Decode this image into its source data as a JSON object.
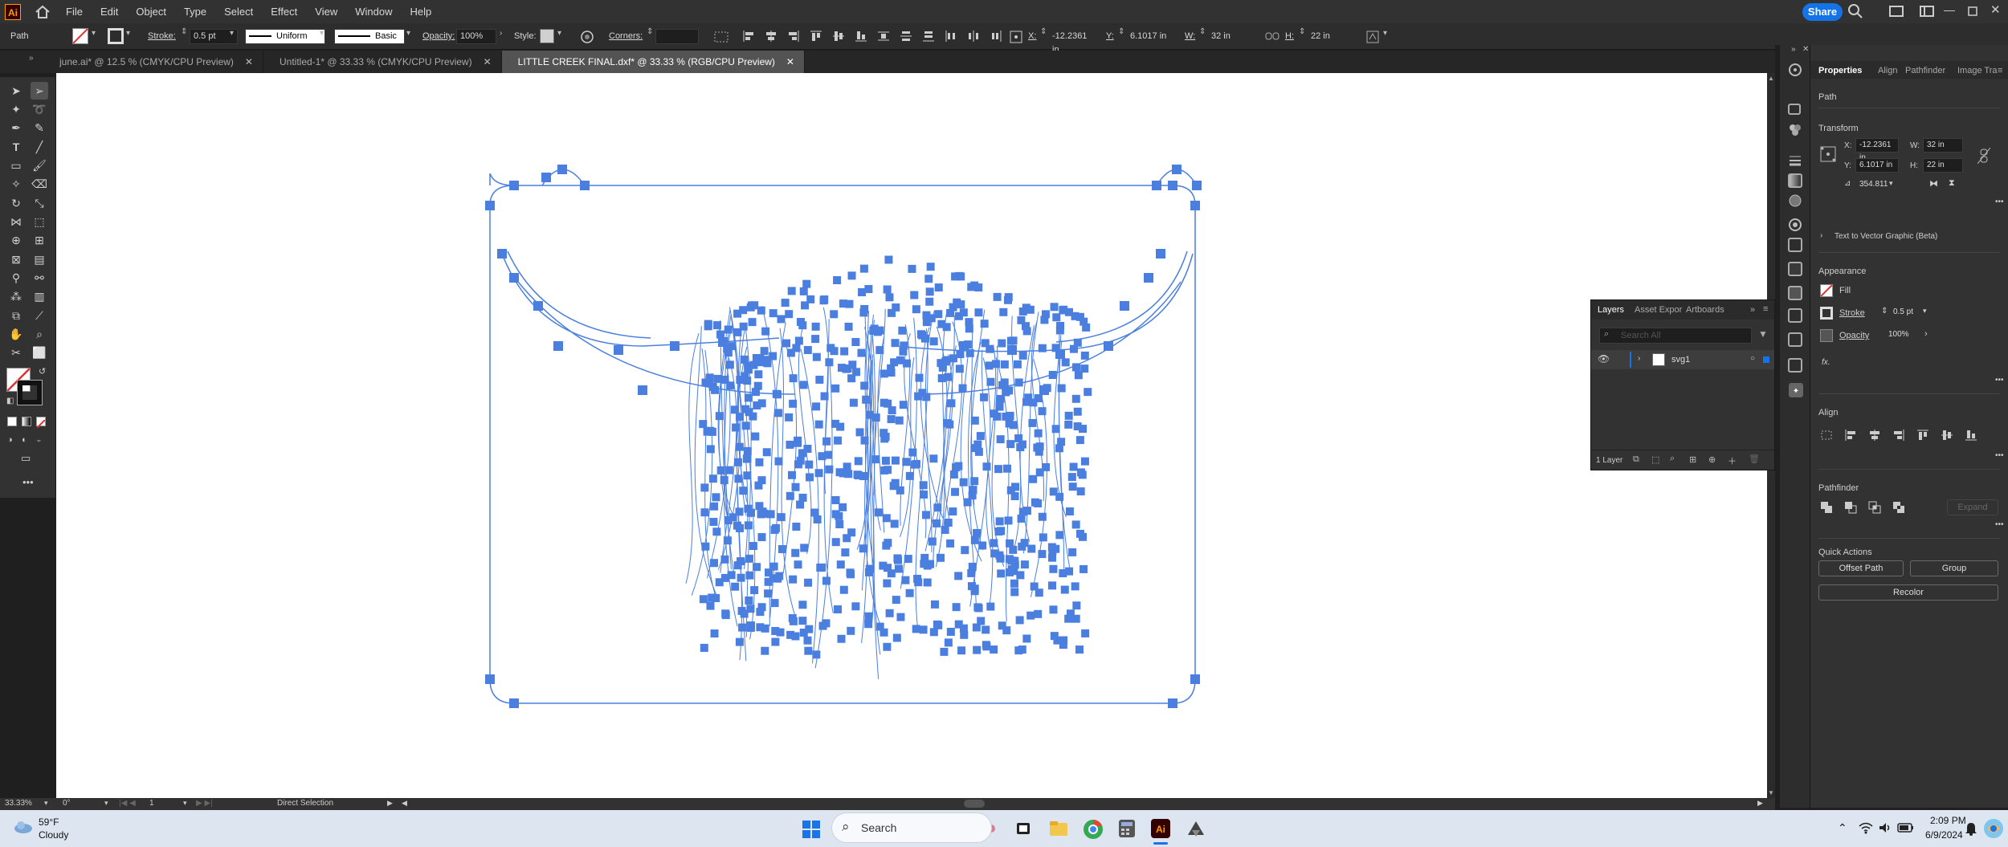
{
  "app": {
    "logo": "Ai",
    "share_label": "Share"
  },
  "menu": [
    "File",
    "Edit",
    "Object",
    "Type",
    "Select",
    "Effect",
    "View",
    "Window",
    "Help"
  ],
  "control": {
    "selection_type": "Path",
    "stroke_label": "Stroke:",
    "stroke_value": "0.5 pt",
    "profile_value": "Uniform",
    "brush_value": "Basic",
    "opacity_label": "Opacity:",
    "opacity_value": "100%",
    "style_label": "Style:",
    "corners_label": "Corners:",
    "x_label": "X:",
    "x_value": "-12.2361 in",
    "y_label": "Y:",
    "y_value": "6.1017 in",
    "w_label": "W:",
    "w_value": "32 in",
    "h_label": "H:",
    "h_value": "22 in"
  },
  "tabs": [
    {
      "label": "june.ai* @ 12.5 % (CMYK/CPU Preview)",
      "active": false
    },
    {
      "label": "Untitled-1* @ 33.33 % (CMYK/CPU Preview)",
      "active": false
    },
    {
      "label": "LITTLE CREEK FINAL.dxf* @ 33.33 % (RGB/CPU Preview)",
      "active": true
    }
  ],
  "status": {
    "zoom": "33.33%",
    "rotation": "0°",
    "artboard": "1",
    "tool": "Direct Selection"
  },
  "properties": {
    "tabs": [
      "Properties",
      "Align",
      "Pathfinder",
      "Image Tra"
    ],
    "selection": "Path",
    "transform_title": "Transform",
    "x_label": "X:",
    "x": "-12.2361 in",
    "y_label": "Y:",
    "y": "6.1017 in",
    "w_label": "W:",
    "w": "32 in",
    "h_label": "H:",
    "h": "22 in",
    "angle": "354.811",
    "text_to_vector": "Text to Vector Graphic (Beta)",
    "appearance_title": "Appearance",
    "fill_label": "Fill",
    "stroke_label": "Stroke",
    "stroke_value": "0.5 pt",
    "opacity_label": "Opacity",
    "opacity_value": "100%",
    "fx_label": "fx.",
    "align_title": "Align",
    "pathfinder_title": "Pathfinder",
    "expand_label": "Expand",
    "quick_actions_title": "Quick Actions",
    "offset_path": "Offset Path",
    "group": "Group",
    "recolor": "Recolor"
  },
  "layers": {
    "tabs": [
      "Layers",
      "Asset Expor",
      "Artboards"
    ],
    "search_placeholder": "Search All",
    "layer_name": "svg1",
    "count": "1 Layer"
  },
  "taskbar": {
    "temp": "59°F",
    "weather": "Cloudy",
    "search_label": "Search",
    "time": "2:09 PM",
    "date": "6/9/2024"
  },
  "colors": {
    "accent": "#1473e6",
    "path_color": "#4a7fe0",
    "stroke_swatch": "#e03030"
  }
}
